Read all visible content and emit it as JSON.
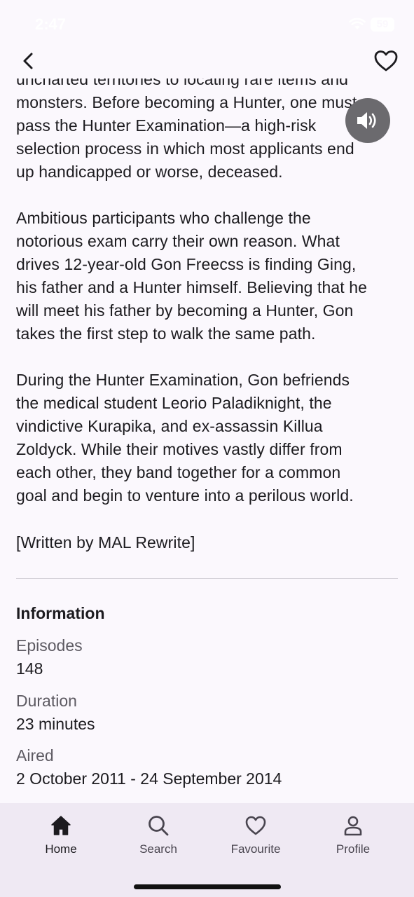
{
  "status": {
    "time": "2:47",
    "battery": "59"
  },
  "header": {
    "back_icon": "chevron-left-icon",
    "favourite_icon": "heart-outline-icon"
  },
  "synopsis": {
    "paragraph_1_lines": [
      "uncharted territories to locating rare items and",
      "monsters. Before becoming a Hunter, one must",
      "pass the Hunter Examination—a high-risk",
      "selection process in which most applicants end",
      "up handicapped or worse, deceased."
    ],
    "paragraph_2_lines": [
      "Ambitious participants who challenge the",
      "notorious exam carry their own reason. What",
      "drives 12-year-old Gon Freecss is finding Ging,",
      "his father and a Hunter himself. Believing that he",
      "will meet his father by becoming a Hunter, Gon",
      "takes the first step to walk the same path."
    ],
    "paragraph_3_lines": [
      "During the Hunter Examination, Gon befriends",
      "the medical student Leorio Paladiknight, the",
      "vindictive Kurapika, and ex-assassin Killua",
      "Zoldyck. While their motives vastly differ from",
      "each other, they band together for a common",
      "goal and begin to venture into a perilous world."
    ],
    "credit": "[Written by MAL Rewrite]"
  },
  "speaker_icon": "speaker-volume-icon",
  "information": {
    "title": "Information",
    "episodes_label": "Episodes",
    "episodes_value": "148",
    "duration_label": "Duration",
    "duration_value": "23 minutes",
    "aired_label": "Aired",
    "aired_value": "2 October 2011 - 24 September 2014"
  },
  "bottom_nav": [
    {
      "label": "Home",
      "icon": "home-icon",
      "active": true
    },
    {
      "label": "Search",
      "icon": "search-icon",
      "active": false
    },
    {
      "label": "Favourite",
      "icon": "heart-icon",
      "active": false
    },
    {
      "label": "Profile",
      "icon": "profile-icon",
      "active": false
    }
  ]
}
